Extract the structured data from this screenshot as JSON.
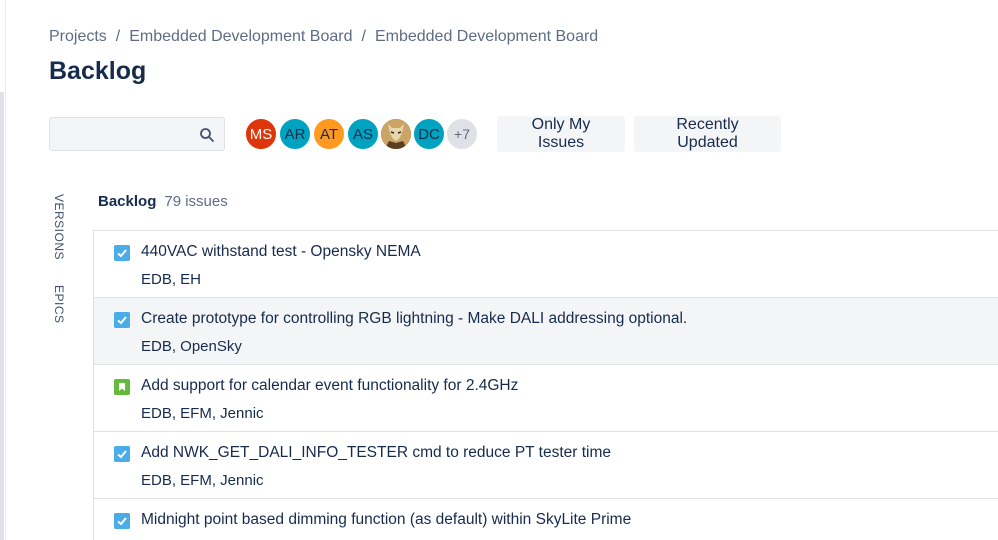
{
  "breadcrumbs": {
    "items": [
      "Projects",
      "Embedded Development Board",
      "Embedded Development Board"
    ],
    "separator": "/"
  },
  "page": {
    "title": "Backlog"
  },
  "search": {
    "value": "",
    "placeholder": "",
    "icon": "search-icon"
  },
  "avatars": [
    {
      "initials": "MS",
      "color": "#de350b"
    },
    {
      "initials": "AR",
      "color": "#00a3bf"
    },
    {
      "initials": "AT",
      "color": "#ff991f"
    },
    {
      "initials": "AS",
      "color": "#00a3bf"
    },
    {
      "initials": "",
      "color": "#6b5430"
    },
    {
      "initials": "DC",
      "color": "#00a3bf"
    }
  ],
  "avatars_more": "+7",
  "quick_filters": {
    "only_my_issues": "Only My Issues",
    "recently_updated": "Recently Updated"
  },
  "side_tabs": {
    "versions": "VERSIONS",
    "epics": "EPICS"
  },
  "backlog": {
    "name": "Backlog",
    "count": "79 issues",
    "issues": [
      {
        "type": "task",
        "summary": "440VAC withstand test - Opensky NEMA",
        "labels": "EDB, EH",
        "selected": false
      },
      {
        "type": "task",
        "summary": "Create prototype for controlling RGB lightning - Make DALI addressing optional.",
        "labels": "EDB, OpenSky",
        "selected": true
      },
      {
        "type": "story",
        "summary": "Add support for calendar event functionality for 2.4GHz",
        "labels": "EDB, EFM, Jennic",
        "selected": false
      },
      {
        "type": "task",
        "summary": "Add NWK_GET_DALI_INFO_TESTER cmd to reduce PT tester time",
        "labels": "EDB, EFM, Jennic",
        "selected": false
      },
      {
        "type": "task",
        "summary": "Midnight point based dimming function (as default) within SkyLite Prime",
        "labels": "",
        "selected": false
      }
    ]
  },
  "colors": {
    "task": "#4bade8",
    "story": "#63ba3c",
    "text": "#172b4d",
    "muted": "#5e6c84"
  }
}
